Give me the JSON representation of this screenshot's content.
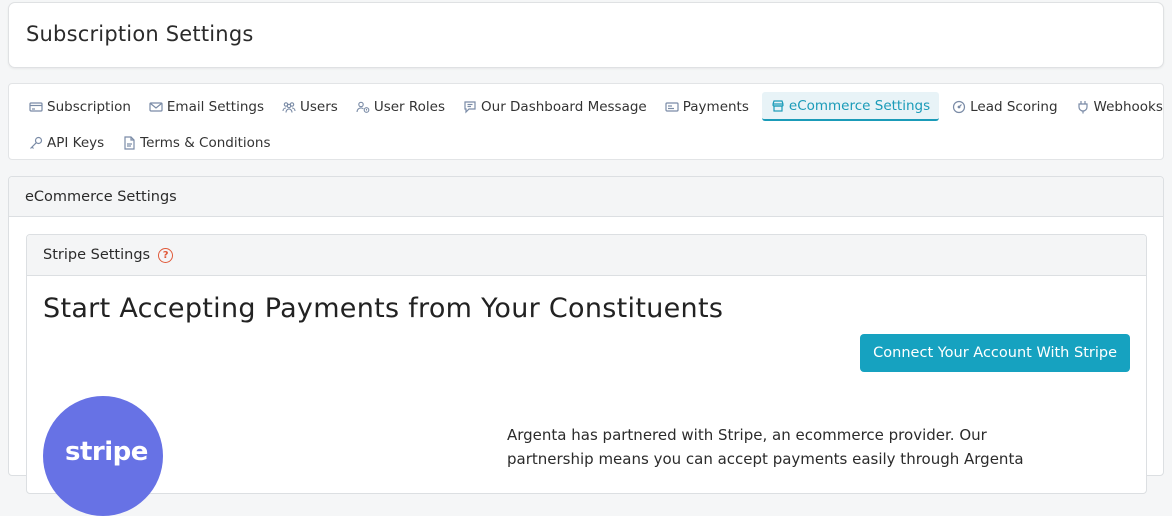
{
  "header": {
    "title": "Subscription Settings"
  },
  "tabs": {
    "row1": [
      {
        "label": "Subscription",
        "icon": "credit-card-icon"
      },
      {
        "label": "Email Settings",
        "icon": "envelope-icon"
      },
      {
        "label": "Users",
        "icon": "users-icon"
      },
      {
        "label": "User Roles",
        "icon": "user-roles-icon"
      },
      {
        "label": "Our Dashboard Message",
        "icon": "message-icon"
      },
      {
        "label": "Payments",
        "icon": "payments-icon"
      },
      {
        "label": "eCommerce Settings",
        "icon": "store-icon",
        "active": true
      },
      {
        "label": "Lead Scoring",
        "icon": "gauge-icon"
      },
      {
        "label": "Webhooks",
        "icon": "plug-icon"
      }
    ],
    "row2": [
      {
        "label": "API Keys",
        "icon": "key-icon"
      },
      {
        "label": "Terms & Conditions",
        "icon": "document-icon"
      }
    ]
  },
  "panel": {
    "title": "eCommerce Settings",
    "stripe": {
      "title": "Stripe Settings",
      "help_glyph": "?",
      "heading": "Start Accepting Payments from Your Constituents",
      "connect_button": "Connect Your Account With Stripe",
      "logo_text": "stripe",
      "description": "Argenta has partnered with Stripe, an ecommerce provider. Our partnership means you can accept payments easily through Argenta"
    }
  },
  "colors": {
    "accent": "#16a2c0",
    "active_tab_bg": "#e8f3f7",
    "stripe_brand": "#6772e5",
    "help_icon": "#e05a3a"
  }
}
